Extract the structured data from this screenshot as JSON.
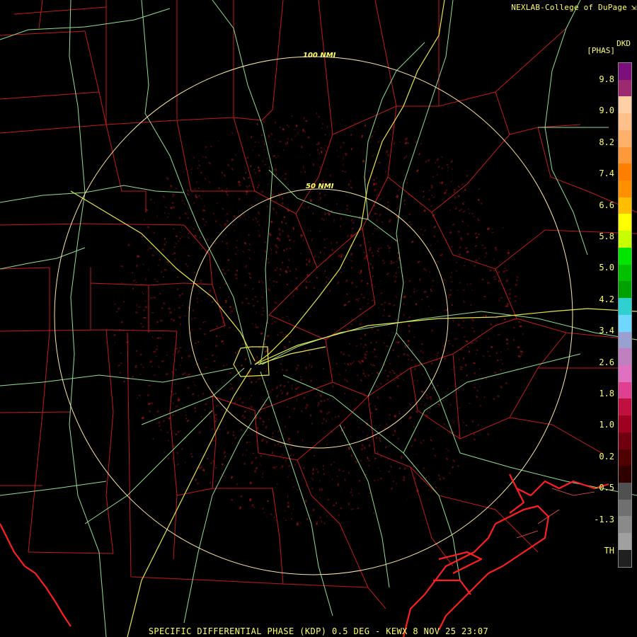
{
  "header": {
    "credit": "NEXLAB-College of DuPage",
    "credit_icon": "resize-icon",
    "product_code": "DKD",
    "unit": "[PHAS]"
  },
  "rings": [
    "100 NMI",
    "50 NMI"
  ],
  "scale": {
    "labels": [
      "9.8",
      "9.0",
      "8.2",
      "7.4",
      "6.6",
      "5.8",
      "5.0",
      "4.2",
      "3.4",
      "2.6",
      "1.8",
      "1.0",
      "0.2",
      "-0.5",
      "-1.3",
      "TH"
    ],
    "colors": [
      "#7b0f7b",
      "#9c2a6e",
      "#ffcfa6",
      "#ffc08c",
      "#ffb06a",
      "#ff9a3c",
      "#ff7f00",
      "#ff9000",
      "#ffbf00",
      "#ffff00",
      "#c8ff00",
      "#00e600",
      "#00c000",
      "#00a000",
      "#30d0d0",
      "#70d8ff",
      "#9aa0d0",
      "#c080c0",
      "#e070c0",
      "#e04090",
      "#c01040",
      "#a00020",
      "#700010",
      "#500000",
      "#300000",
      "#505050",
      "#707070",
      "#8a8a8a",
      "#a0a0a0",
      "#202020"
    ]
  },
  "footer": {
    "product_line": "SPECIFIC DIFFERENTIAL PHASE (KDP) 0.5 DEG - KEWX 8 NOV 25 23:07"
  },
  "colors": {
    "text": "#ffff66",
    "county": "#cc2020",
    "highway": "#90e090",
    "interstate": "#e0e040",
    "coast": "#ff2020",
    "ring": "#ffff99",
    "echo": "#5a0a0a"
  }
}
